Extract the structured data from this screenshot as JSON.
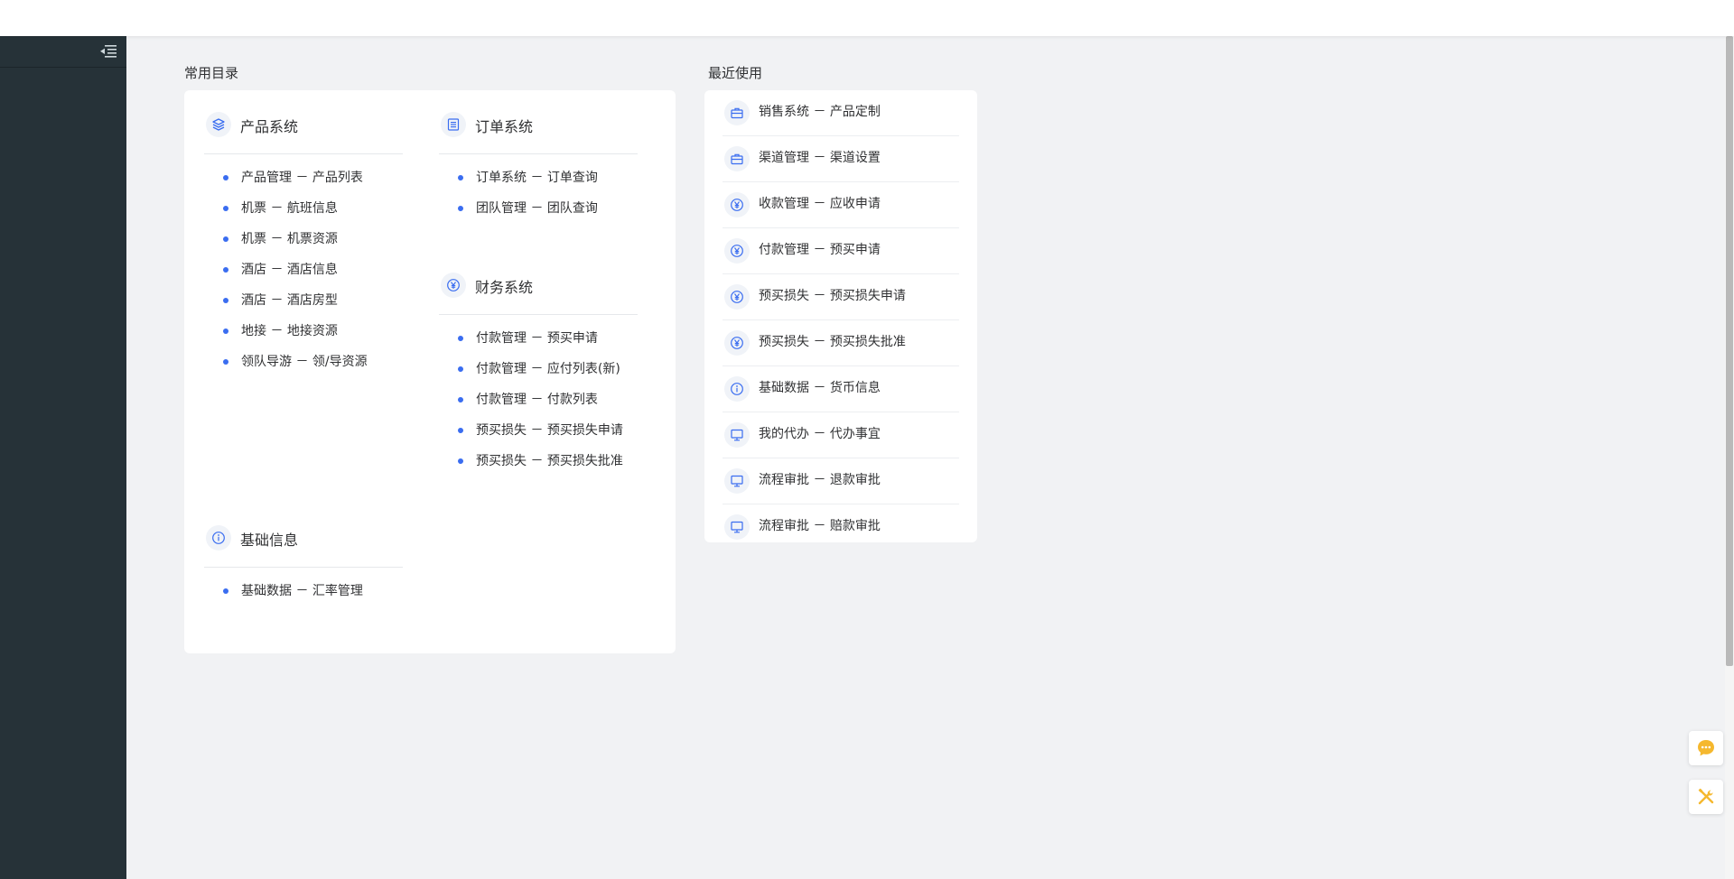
{
  "colors": {
    "accent": "#3a6df0",
    "sidebar": "#263238",
    "background": "#f1f2f4",
    "float_icon": "#f5b82e"
  },
  "sidebar": {
    "collapse_icon": "menu-fold-icon"
  },
  "common_dir": {
    "title": "常用目录",
    "groups": [
      {
        "title": "产品系统",
        "icon": "layers-icon",
        "items": [
          "产品管理 － 产品列表",
          "机票 － 航班信息",
          "机票 － 机票资源",
          "酒店 － 酒店信息",
          "酒店 － 酒店房型",
          "地接 － 地接资源",
          "领队导游 － 领/导资源"
        ]
      },
      {
        "title": "订单系统",
        "icon": "list-icon",
        "items": [
          "订单系统 － 订单查询",
          "团队管理 － 团队查询"
        ]
      },
      {
        "title": "财务系统",
        "icon": "yen-icon",
        "items": [
          "付款管理 － 预买申请",
          "付款管理 － 应付列表(新)",
          "付款管理 － 付款列表",
          "预买损失 － 预买损失申请",
          "预买损失 － 预买损失批准"
        ]
      },
      {
        "title": "基础信息",
        "icon": "info-icon",
        "items": [
          "基础数据 － 汇率管理"
        ]
      }
    ]
  },
  "recent": {
    "title": "最近使用",
    "items": [
      {
        "label": "销售系统 － 产品定制",
        "icon": "briefcase-icon"
      },
      {
        "label": "渠道管理 － 渠道设置",
        "icon": "briefcase-icon"
      },
      {
        "label": "收款管理 － 应收申请",
        "icon": "yen-icon"
      },
      {
        "label": "付款管理 － 预买申请",
        "icon": "yen-icon"
      },
      {
        "label": "预买损失 － 预买损失申请",
        "icon": "yen-icon"
      },
      {
        "label": "预买损失 － 预买损失批准",
        "icon": "yen-icon"
      },
      {
        "label": "基础数据 － 货币信息",
        "icon": "info-icon"
      },
      {
        "label": "我的代办 － 代办事宜",
        "icon": "monitor-icon"
      },
      {
        "label": "流程审批 － 退款审批",
        "icon": "monitor-icon"
      },
      {
        "label": "流程审批 － 赔款审批",
        "icon": "monitor-icon"
      }
    ]
  },
  "floating": {
    "chat_icon": "chat-bubble-icon",
    "tools_icon": "tools-icon"
  }
}
